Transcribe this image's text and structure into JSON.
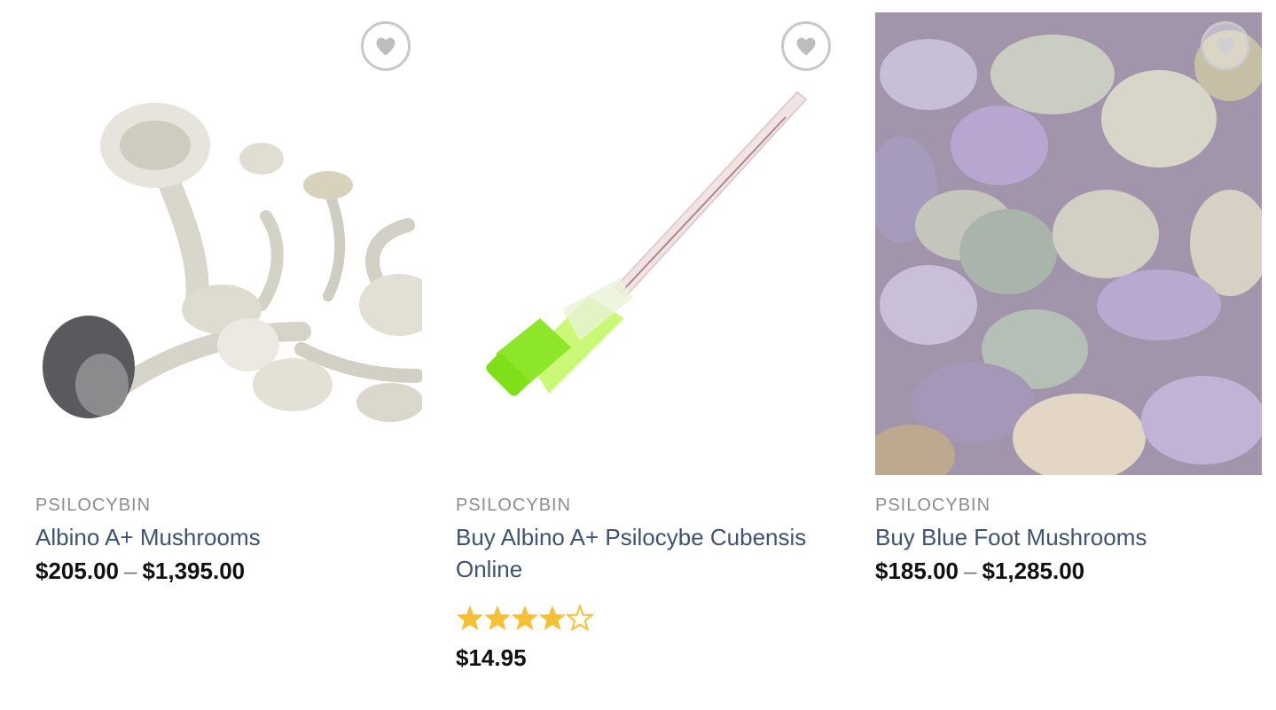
{
  "products": [
    {
      "category": "PSILOCYBIN",
      "title": "Albino A+ Mushrooms",
      "price_low": "$205.00",
      "price_sep": "–",
      "price_high": "$1,395.00",
      "image": "white-dried-mushrooms-photo"
    },
    {
      "category": "PSILOCYBIN",
      "title_line1": "Buy Albino A+ Psilocybe Cubensis",
      "title_line2": "Online",
      "rating": 4,
      "rating_max": 5,
      "price": "$14.95",
      "image": "green-hub-needle-photo"
    },
    {
      "category": "PSILOCYBIN",
      "title": "Buy Blue Foot Mushrooms",
      "price_low": "$185.00",
      "price_sep": "–",
      "price_high": "$1,285.00",
      "image": "blue-foot-mushrooms-photo"
    }
  ],
  "colors": {
    "title": "#3e5273",
    "category": "#8d8d8d",
    "price": "#111111",
    "star": "#f5c033",
    "wishlist_border": "#c8c8c8"
  },
  "icons": {
    "wishlist": "heart-icon",
    "rating": "star-icon"
  }
}
